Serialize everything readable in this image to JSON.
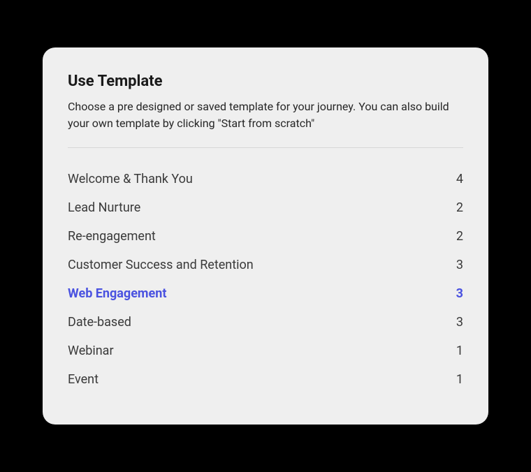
{
  "header": {
    "title": "Use Template",
    "description": "Choose a pre designed or saved template for your journey. You can also build your own template by clicking \"Start from scratch\""
  },
  "templates": {
    "items": [
      {
        "label": "Welcome & Thank You",
        "count": "4",
        "selected": false
      },
      {
        "label": "Lead Nurture",
        "count": "2",
        "selected": false
      },
      {
        "label": "Re-engagement",
        "count": "2",
        "selected": false
      },
      {
        "label": "Customer Success and Retention",
        "count": "3",
        "selected": false
      },
      {
        "label": "Web Engagement",
        "count": "3",
        "selected": true
      },
      {
        "label": "Date-based",
        "count": "3",
        "selected": false
      },
      {
        "label": "Webinar",
        "count": "1",
        "selected": false
      },
      {
        "label": "Event",
        "count": "1",
        "selected": false
      }
    ]
  }
}
